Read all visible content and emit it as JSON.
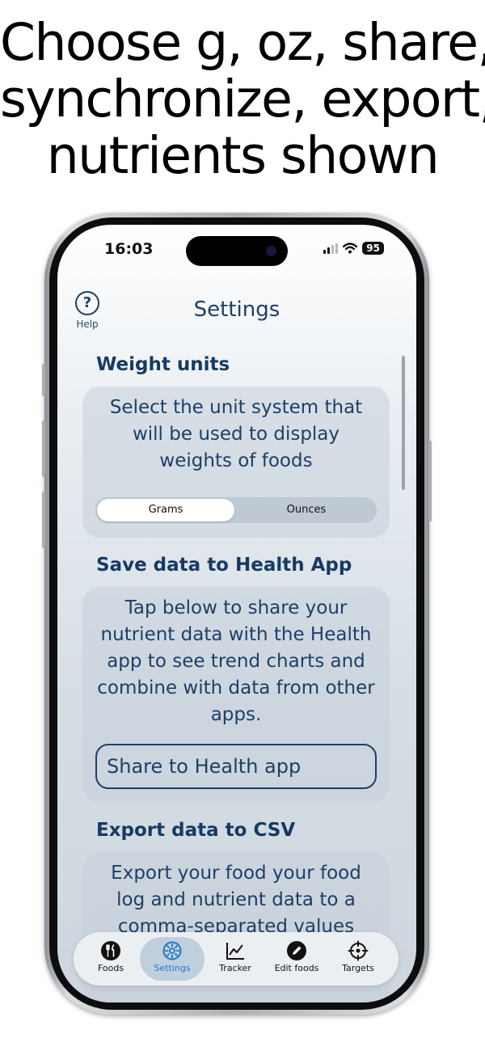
{
  "headline": {
    "line1": "Choose g, oz, share,",
    "line2": "synchronize, export,",
    "line3": "nutrients shown"
  },
  "status_bar": {
    "time": "16:03",
    "battery": "95"
  },
  "header": {
    "title": "Settings",
    "help_label": "Help",
    "help_icon": "?"
  },
  "sections": {
    "weight": {
      "title": "Weight units",
      "description": "Select the unit system that will be used to display weights of foods",
      "options": [
        "Grams",
        "Ounces"
      ],
      "selected": "Grams"
    },
    "health": {
      "title": "Save data to Health App",
      "description": "Tap below to share your nutrient data with the Health app to see trend charts and combine with data from other apps.",
      "button_label": "Share to Health app"
    },
    "export": {
      "title": "Export data to CSV",
      "description": "Export your food your food log and nutrient data to a comma-separated values"
    }
  },
  "tabbar": {
    "items": [
      {
        "label": "Foods",
        "icon": "fork-knife-icon"
      },
      {
        "label": "Settings",
        "icon": "gear-icon"
      },
      {
        "label": "Tracker",
        "icon": "chart-icon"
      },
      {
        "label": "Edit foods",
        "icon": "pencil-icon"
      },
      {
        "label": "Targets",
        "icon": "target-icon"
      }
    ],
    "active": "Settings"
  },
  "colors": {
    "accent": "#1e3f66",
    "tab_active": "#2678c8"
  }
}
